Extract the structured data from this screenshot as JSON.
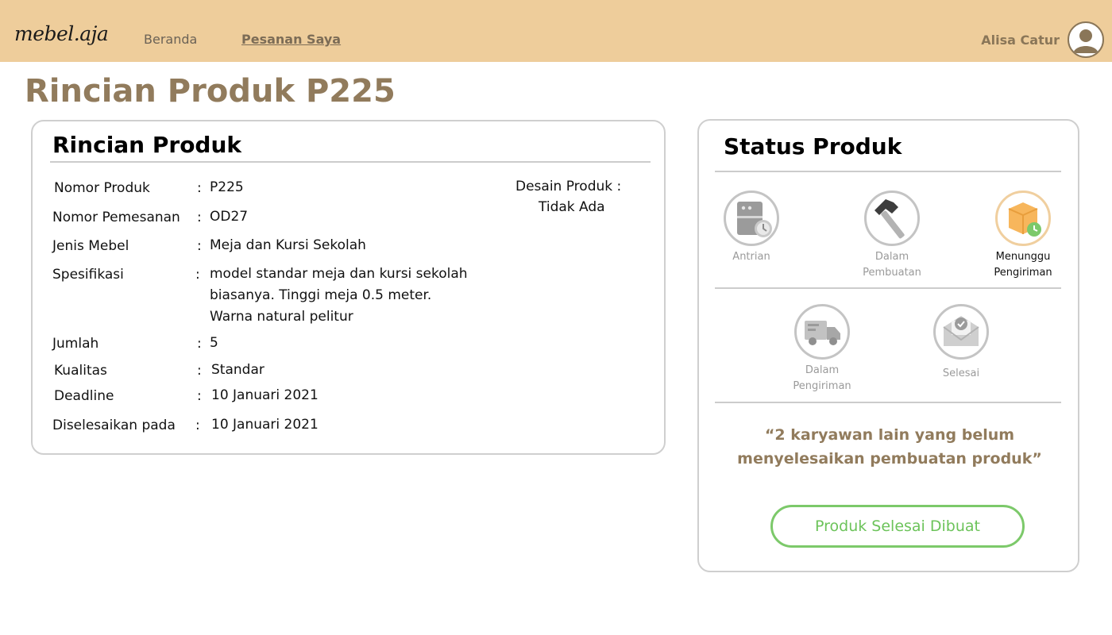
{
  "nav": {
    "logo": "mebel.aja",
    "home": "Beranda",
    "orders": "Pesanan Saya",
    "user_name": "Alisa Catur"
  },
  "page_title": "Rincian Produk P225",
  "detail": {
    "title": "Rincian Produk",
    "colon": ":",
    "rows": [
      {
        "label": "Nomor Produk",
        "value": "P225"
      },
      {
        "label": "Nomor Pemesanan",
        "value": "OD27"
      },
      {
        "label": "Jenis Mebel",
        "value": "Meja dan Kursi Sekolah"
      },
      {
        "label": "Spesifikasi",
        "value_lines": [
          "model standar meja dan kursi sekolah",
          "biasanya. Tinggi meja 0.5 meter.",
          "Warna natural pelitur"
        ]
      },
      {
        "label": "Jumlah",
        "value": "5"
      },
      {
        "label": "Kualitas",
        "value": "Standar"
      },
      {
        "label": "Deadline",
        "value": "10 Januari 2021"
      },
      {
        "label": "Diselesaikan pada",
        "value": "10 Januari 2021"
      }
    ],
    "design_label": "Desain Produk  :",
    "design_value": "Tidak Ada"
  },
  "status": {
    "title": "Status Produk",
    "steps": [
      {
        "label_lines": [
          "Antrian"
        ],
        "icon": "queue-server-clock-icon",
        "active": false
      },
      {
        "label_lines": [
          "Dalam",
          "Pembuatan"
        ],
        "icon": "hammer-icon",
        "active": false
      },
      {
        "label_lines": [
          "Menunggu",
          "Pengiriman"
        ],
        "icon": "package-clock-icon",
        "active": true
      },
      {
        "label_lines": [
          "Dalam",
          "Pengiriman"
        ],
        "icon": "delivery-truck-icon",
        "active": false
      },
      {
        "label_lines": [
          "Selesai"
        ],
        "icon": "envelope-check-icon",
        "active": false
      }
    ],
    "quote": "“2 karyawan lain yang belum menyelesaikan pembuatan produk”",
    "button_label": "Produk Selesai Dibuat"
  },
  "colors": {
    "navbar": "#eecd9b",
    "accent_brown": "#917b5c",
    "success_green": "#7cc96a",
    "active_step": "#f0cf9f"
  }
}
